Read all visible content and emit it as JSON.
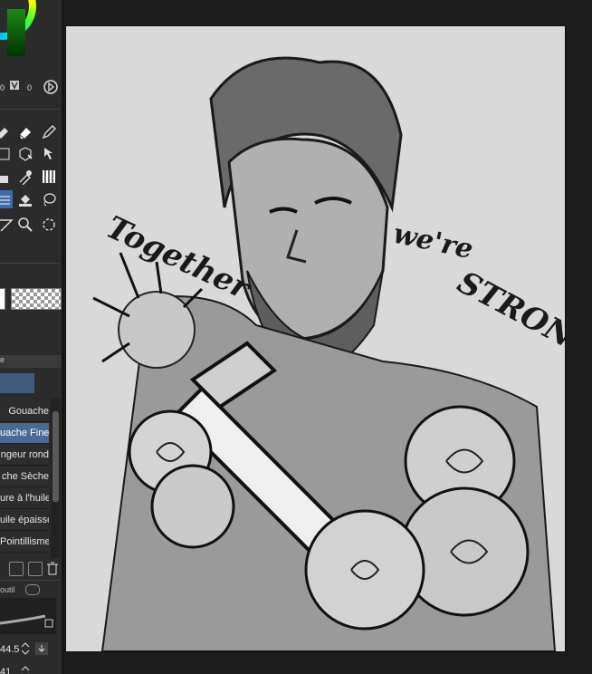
{
  "color_panel": {
    "values": [
      "0",
      "0"
    ],
    "colors": {
      "accent": "#4a6a95"
    }
  },
  "tools": [
    {
      "name": "eraser-icon"
    },
    {
      "name": "pen-icon"
    },
    {
      "name": "3d-object-icon"
    },
    {
      "name": "select-object-icon"
    },
    {
      "name": "eyedropper-icon"
    },
    {
      "name": "gradient-icon"
    },
    {
      "name": "fill-icon"
    },
    {
      "name": "lasso-icon"
    },
    {
      "name": "ruler-icon"
    },
    {
      "name": "zoom-icon"
    },
    {
      "name": "rotate-icon"
    }
  ],
  "subtool_tab": {
    "label": "e"
  },
  "brushes": [
    {
      "label": "Gouache",
      "active": false
    },
    {
      "label": "uache Fine",
      "active": true
    },
    {
      "label": "ngeur rond",
      "active": false
    },
    {
      "label": "che Sèche",
      "active": false
    },
    {
      "label": "ure à l'huile",
      "active": false
    },
    {
      "label": "uile épaisse",
      "active": false
    },
    {
      "label": "Pointillisme",
      "active": false
    }
  ],
  "tool_property": {
    "label": "outil"
  },
  "brush_size": "44.5",
  "opacity": "41",
  "canvas": {
    "text_left": "Together",
    "text_right_top": "we're",
    "text_right_bottom": "STRONG"
  }
}
